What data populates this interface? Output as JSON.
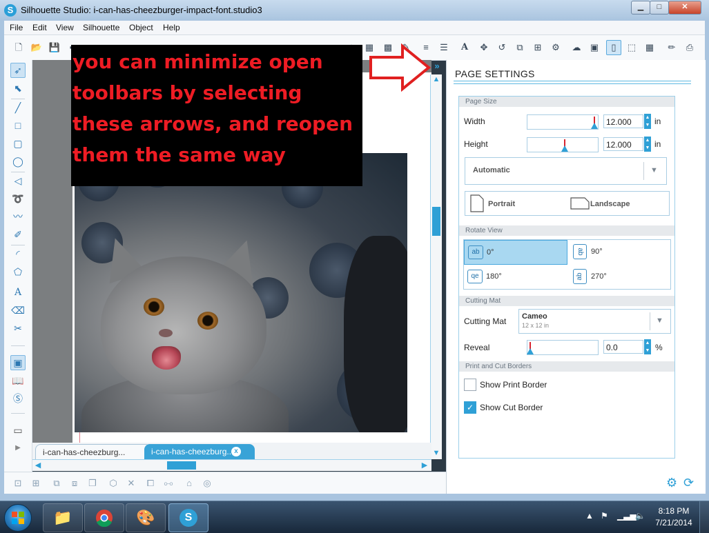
{
  "window": {
    "title": "Silhouette Studio: i-can-has-cheezburger-impact-font.studio3",
    "app_icon_letter": "S",
    "minimize": "▁",
    "maximize": "□",
    "close": "✕"
  },
  "menu": [
    "File",
    "Edit",
    "View",
    "Silhouette",
    "Object",
    "Help"
  ],
  "annotation": {
    "text": "you can minimize open toolbars by selecting these arrows, and reopen them the same way",
    "color": "#ee1c24"
  },
  "collapse_arrows": "»",
  "tabs": [
    {
      "label": "i-can-has-cheezburg...",
      "active": false
    },
    {
      "label": "i-can-has-cheezburg...",
      "active": true,
      "close": "x"
    }
  ],
  "panel": {
    "title": "PAGE SETTINGS",
    "page_size": {
      "section": "Page Size",
      "width_label": "Width",
      "width_value": "12.000",
      "height_label": "Height",
      "height_value": "12.000",
      "unit": "in",
      "preset": "Automatic",
      "portrait": "Portrait",
      "landscape": "Landscape"
    },
    "rotate_view": {
      "section": "Rotate View",
      "options": [
        {
          "label": "0°",
          "glyph": "ab",
          "selected": true
        },
        {
          "label": "90°",
          "glyph": "ab",
          "selected": false
        },
        {
          "label": "180°",
          "glyph": "qe",
          "selected": false
        },
        {
          "label": "270°",
          "glyph": "ab",
          "selected": false
        }
      ]
    },
    "cutting_mat": {
      "section": "Cutting Mat",
      "label": "Cutting Mat",
      "value": "Cameo",
      "sub": "12 x 12 in",
      "reveal_label": "Reveal",
      "reveal_value": "0.0",
      "reveal_unit": "%"
    },
    "borders": {
      "section": "Print and Cut Borders",
      "print_label": "Show Print Border",
      "print_checked": false,
      "cut_label": "Show Cut Border",
      "cut_checked": true
    }
  },
  "taskbar": {
    "time": "8:18 PM",
    "date": "7/21/2014"
  },
  "colors": {
    "accent": "#2fa0d6",
    "annotation": "#ee1c24"
  }
}
